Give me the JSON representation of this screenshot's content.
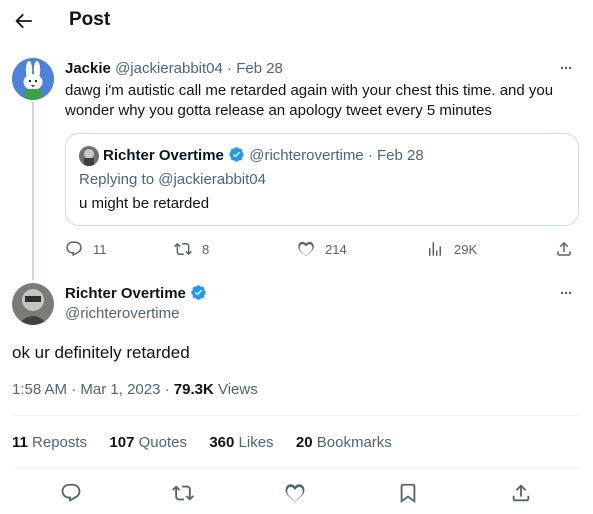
{
  "header": {
    "title": "Post"
  },
  "parent_post": {
    "display_name": "Jackie",
    "handle": "@jackierabbit04",
    "separator": "·",
    "date": "Feb 28",
    "text": "dawg i'm autistic call me retarded again with your chest this time. and you wonder why you gotta release an apology tweet every 5 minutes",
    "more_label": "···"
  },
  "quote": {
    "display_name": "Richter Overtime",
    "handle": "@richterovertime",
    "separator": "·",
    "date": "Feb 28",
    "replying_to": "Replying to @jackierabbit04",
    "text": "u might be retarded"
  },
  "parent_actions": {
    "replies": "11",
    "reposts": "8",
    "likes": "214",
    "views": "29K"
  },
  "main_post": {
    "display_name": "Richter Overtime",
    "handle": "@richterovertime",
    "more_label": "···",
    "text": "ok ur definitely retarded",
    "time": "1:58 AM",
    "separator": "·",
    "date": "Mar 1, 2023",
    "views_count": "79.3K",
    "views_label": "Views"
  },
  "stats": {
    "reposts_count": "11",
    "reposts_label": "Reposts",
    "quotes_count": "107",
    "quotes_label": "Quotes",
    "likes_count": "360",
    "likes_label": "Likes",
    "bookmarks_count": "20",
    "bookmarks_label": "Bookmarks"
  },
  "colors": {
    "verified": "#1d9bf0",
    "text": "#0f1419",
    "muted": "#536471",
    "border": "#cfd9de",
    "divider": "#eff3f4"
  }
}
